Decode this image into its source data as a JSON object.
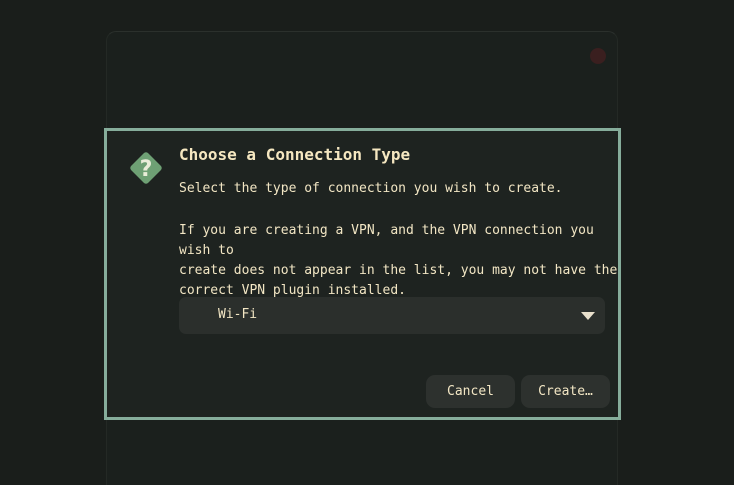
{
  "dialog": {
    "icon": "question-diamond-icon",
    "title": "Choose a Connection Type",
    "message": "Select the type of connection you wish to create.",
    "details": "If you are creating a VPN, and the VPN connection you wish to\ncreate does not appear in the list, you may not have the\ncorrect VPN plugin installed.",
    "connection_type": {
      "selected": "Wi-Fi"
    },
    "buttons": {
      "cancel": "Cancel",
      "create": "Create…"
    }
  },
  "colors": {
    "background": "#1a1e1b",
    "dialog_border": "#86ad9b",
    "dialog_bg": "#1e2320",
    "text": "#f2e6c4",
    "icon_fill": "#6ea074",
    "button_bg": "#2d312e"
  }
}
